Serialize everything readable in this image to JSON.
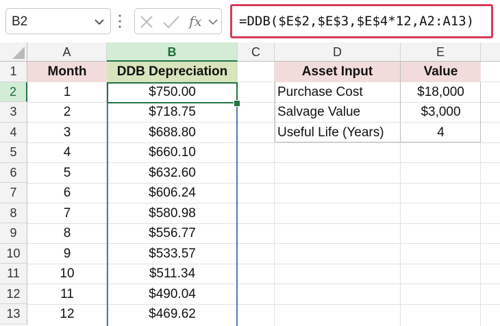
{
  "name_box": {
    "value": "B2",
    "chevron_icon": "chevron-down-icon"
  },
  "formula_bar": {
    "cancel_icon": "close-icon",
    "enter_icon": "checkmark-icon",
    "fx_icon": "function-icon",
    "formula": "=DDB($E$2,$E$3,$E$4*12,A2:A13)"
  },
  "columns": [
    "A",
    "B",
    "C",
    "D",
    "E"
  ],
  "rows": [
    "1",
    "2",
    "3",
    "4",
    "5",
    "6",
    "7",
    "8",
    "9",
    "10",
    "11",
    "12",
    "13"
  ],
  "table": {
    "headers": {
      "month": "Month",
      "ddb": "DDB Depreciation"
    },
    "rows": [
      {
        "month": "1",
        "ddb": "$750.00"
      },
      {
        "month": "2",
        "ddb": "$718.75"
      },
      {
        "month": "3",
        "ddb": "$688.80"
      },
      {
        "month": "4",
        "ddb": "$660.10"
      },
      {
        "month": "5",
        "ddb": "$632.60"
      },
      {
        "month": "6",
        "ddb": "$606.24"
      },
      {
        "month": "7",
        "ddb": "$580.98"
      },
      {
        "month": "8",
        "ddb": "$556.77"
      },
      {
        "month": "9",
        "ddb": "$533.57"
      },
      {
        "month": "10",
        "ddb": "$511.34"
      },
      {
        "month": "11",
        "ddb": "$490.04"
      },
      {
        "month": "12",
        "ddb": "$469.62"
      }
    ]
  },
  "asset_table": {
    "headers": {
      "input": "Asset Input",
      "value": "Value"
    },
    "rows": [
      {
        "input": "Purchase Cost",
        "value": "$18,000"
      },
      {
        "input": "Salvage Value",
        "value": "$3,000"
      },
      {
        "input": "Useful Life (Years)",
        "value": "4"
      }
    ]
  },
  "colors": {
    "header_fill_pink": "#f2dcdb",
    "header_fill_green": "#d8e4bc",
    "selection_green": "#217346",
    "formula_border": "#d63a56",
    "range_blue": "#4a78c2"
  }
}
